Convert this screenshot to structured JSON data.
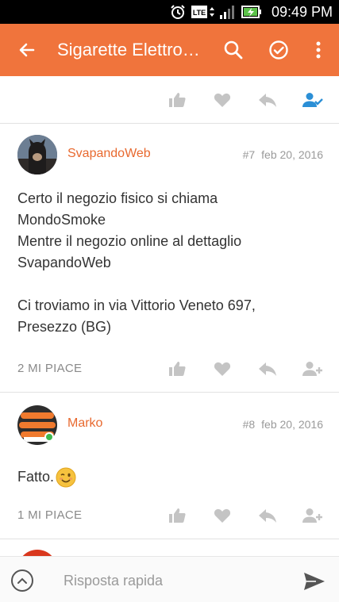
{
  "status_bar": {
    "time": "09:49 PM",
    "network": "LTE"
  },
  "app_bar": {
    "title": "Sigarette Elettro…"
  },
  "colors": {
    "accent": "#f0743c",
    "author": "#e8692f",
    "icon_gray": "#c4c4c4",
    "liked_blue": "#2b8fd6",
    "online": "#3fb950"
  },
  "posts": [
    {
      "author": "SvapandoWeb",
      "number": "#7",
      "date": "feb 20, 2016",
      "lines": [
        "Certo il negozio fisico si chiama",
        "MondoSmoke",
        "Mentre il negozio online al dettaglio",
        "SvapandoWeb",
        "",
        "Ci troviamo in via Vittorio Veneto 697,",
        "Presezzo (BG)"
      ],
      "likes": "2 MI PIACE"
    },
    {
      "author": "Marko",
      "number": "#8",
      "date": "feb 20, 2016",
      "text": "Fatto.",
      "emoji": "wink-emoji",
      "likes": "1 MI PIACE"
    }
  ],
  "bottom_bar": {
    "reply_placeholder": "Risposta rapida"
  }
}
